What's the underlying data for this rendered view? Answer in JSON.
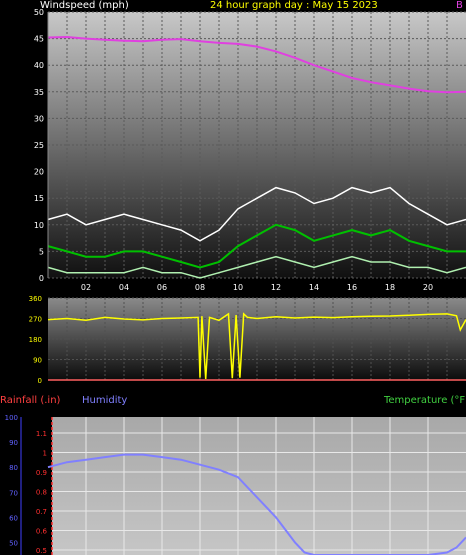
{
  "header": {
    "title": "24 hour graph day : May 15 2023",
    "wind_label": "Windspeed (mph)",
    "clip_label": "B"
  },
  "lower_header": {
    "rainfall_label": "Rainfall (.in)",
    "humidity_label": "Humidity",
    "temperature_label": "Temperature (°F)"
  },
  "colors": {
    "barometer": "#e040e0",
    "gust": "#ffffff",
    "wind_avg": "#00c000",
    "wind_low": "#b0f0b0",
    "direction": "#ffff00",
    "rain_axis": "#ff4040",
    "humidity": "#8080ff",
    "temperature": "#40d040",
    "title": "#ffff00"
  },
  "chart_data": [
    {
      "type": "line",
      "title": "24 hour graph day : May 15 2023",
      "ylabel": "Windspeed (mph)",
      "ylim": [
        0,
        50
      ],
      "yticks": [
        "0",
        "5",
        "10",
        "15",
        "20",
        "25",
        "30",
        "35",
        "40",
        "45",
        "50"
      ],
      "xlim": [
        0,
        22
      ],
      "xticks": [
        "02",
        "04",
        "06",
        "08",
        "10",
        "12",
        "14",
        "16",
        "18",
        "20"
      ],
      "grid": true,
      "series": [
        {
          "role": "barometer",
          "x": [
            0,
            1,
            2,
            3,
            4,
            5,
            6,
            7,
            8,
            9,
            10,
            11,
            12,
            13,
            14,
            15,
            16,
            17,
            18,
            19,
            20,
            21,
            22
          ],
          "values": [
            45.2,
            45.3,
            45.0,
            44.8,
            44.6,
            44.5,
            44.8,
            44.9,
            44.5,
            44.2,
            44.0,
            43.5,
            42.6,
            41.4,
            40.0,
            38.8,
            37.6,
            36.8,
            36.2,
            35.6,
            35.1,
            34.9,
            35.0
          ]
        },
        {
          "role": "gust",
          "x": [
            0,
            1,
            2,
            3,
            4,
            5,
            6,
            7,
            8,
            9,
            10,
            11,
            12,
            13,
            14,
            15,
            16,
            17,
            18,
            19,
            20,
            21,
            22
          ],
          "values": [
            11,
            12,
            10,
            11,
            12,
            11,
            10,
            9,
            7,
            9,
            13,
            15,
            17,
            16,
            14,
            15,
            17,
            16,
            17,
            14,
            12,
            10,
            11
          ]
        },
        {
          "role": "average",
          "x": [
            0,
            1,
            2,
            3,
            4,
            5,
            6,
            7,
            8,
            9,
            10,
            11,
            12,
            13,
            14,
            15,
            16,
            17,
            18,
            19,
            20,
            21,
            22
          ],
          "values": [
            6,
            5,
            4,
            4,
            5,
            5,
            4,
            3,
            2,
            3,
            6,
            8,
            10,
            9,
            7,
            8,
            9,
            8,
            9,
            7,
            6,
            5,
            5
          ]
        },
        {
          "role": "low",
          "x": [
            0,
            1,
            2,
            3,
            4,
            5,
            6,
            7,
            8,
            9,
            10,
            11,
            12,
            13,
            14,
            15,
            16,
            17,
            18,
            19,
            20,
            21,
            22
          ],
          "values": [
            2,
            1,
            1,
            1,
            1,
            2,
            1,
            1,
            0,
            1,
            2,
            3,
            4,
            3,
            2,
            3,
            4,
            3,
            3,
            2,
            2,
            1,
            2
          ]
        }
      ]
    },
    {
      "type": "line",
      "ylim": [
        0,
        360
      ],
      "yticks": [
        "0",
        "90",
        "180",
        "270",
        "360"
      ],
      "xlim": [
        0,
        22
      ],
      "series": [
        {
          "role": "wind_direction",
          "x": [
            0,
            1,
            2,
            3,
            4,
            5,
            6,
            7,
            7.9,
            8,
            8.1,
            8.3,
            8.5,
            9,
            9.5,
            9.7,
            9.9,
            10.1,
            10.3,
            10.5,
            11,
            12,
            13,
            14,
            15,
            16,
            17,
            18,
            19,
            20,
            21,
            21.5,
            21.7,
            22
          ],
          "values": [
            265,
            270,
            262,
            275,
            268,
            264,
            270,
            272,
            275,
            10,
            280,
            5,
            275,
            262,
            290,
            8,
            285,
            10,
            290,
            275,
            270,
            278,
            272,
            276,
            274,
            278,
            280,
            281,
            284,
            288,
            290,
            282,
            220,
            265
          ]
        }
      ]
    },
    {
      "type": "line",
      "yticks_humidity": [
        "50",
        "60",
        "70",
        "80",
        "90",
        "100"
      ],
      "yticks_rain": [
        "0.5",
        "0.6",
        "0.7",
        "0.8",
        "0.9",
        "1",
        "1.1"
      ],
      "humidity_range": [
        45,
        100
      ],
      "rain_range": [
        0.5,
        1.1
      ],
      "xlim": [
        0,
        22
      ],
      "series": [
        {
          "role": "humidity",
          "x": [
            0,
            1,
            2,
            3,
            4,
            5,
            6,
            7,
            8,
            9,
            10,
            10.5,
            11,
            11.5,
            12,
            12.5,
            13,
            13.5,
            14,
            20,
            21,
            21.5,
            22
          ],
          "values": [
            80,
            82,
            83,
            84,
            85,
            85,
            84,
            83,
            81,
            79,
            76,
            72,
            68,
            64,
            60,
            55,
            50,
            46,
            45,
            45,
            46,
            48,
            52
          ]
        }
      ]
    }
  ]
}
